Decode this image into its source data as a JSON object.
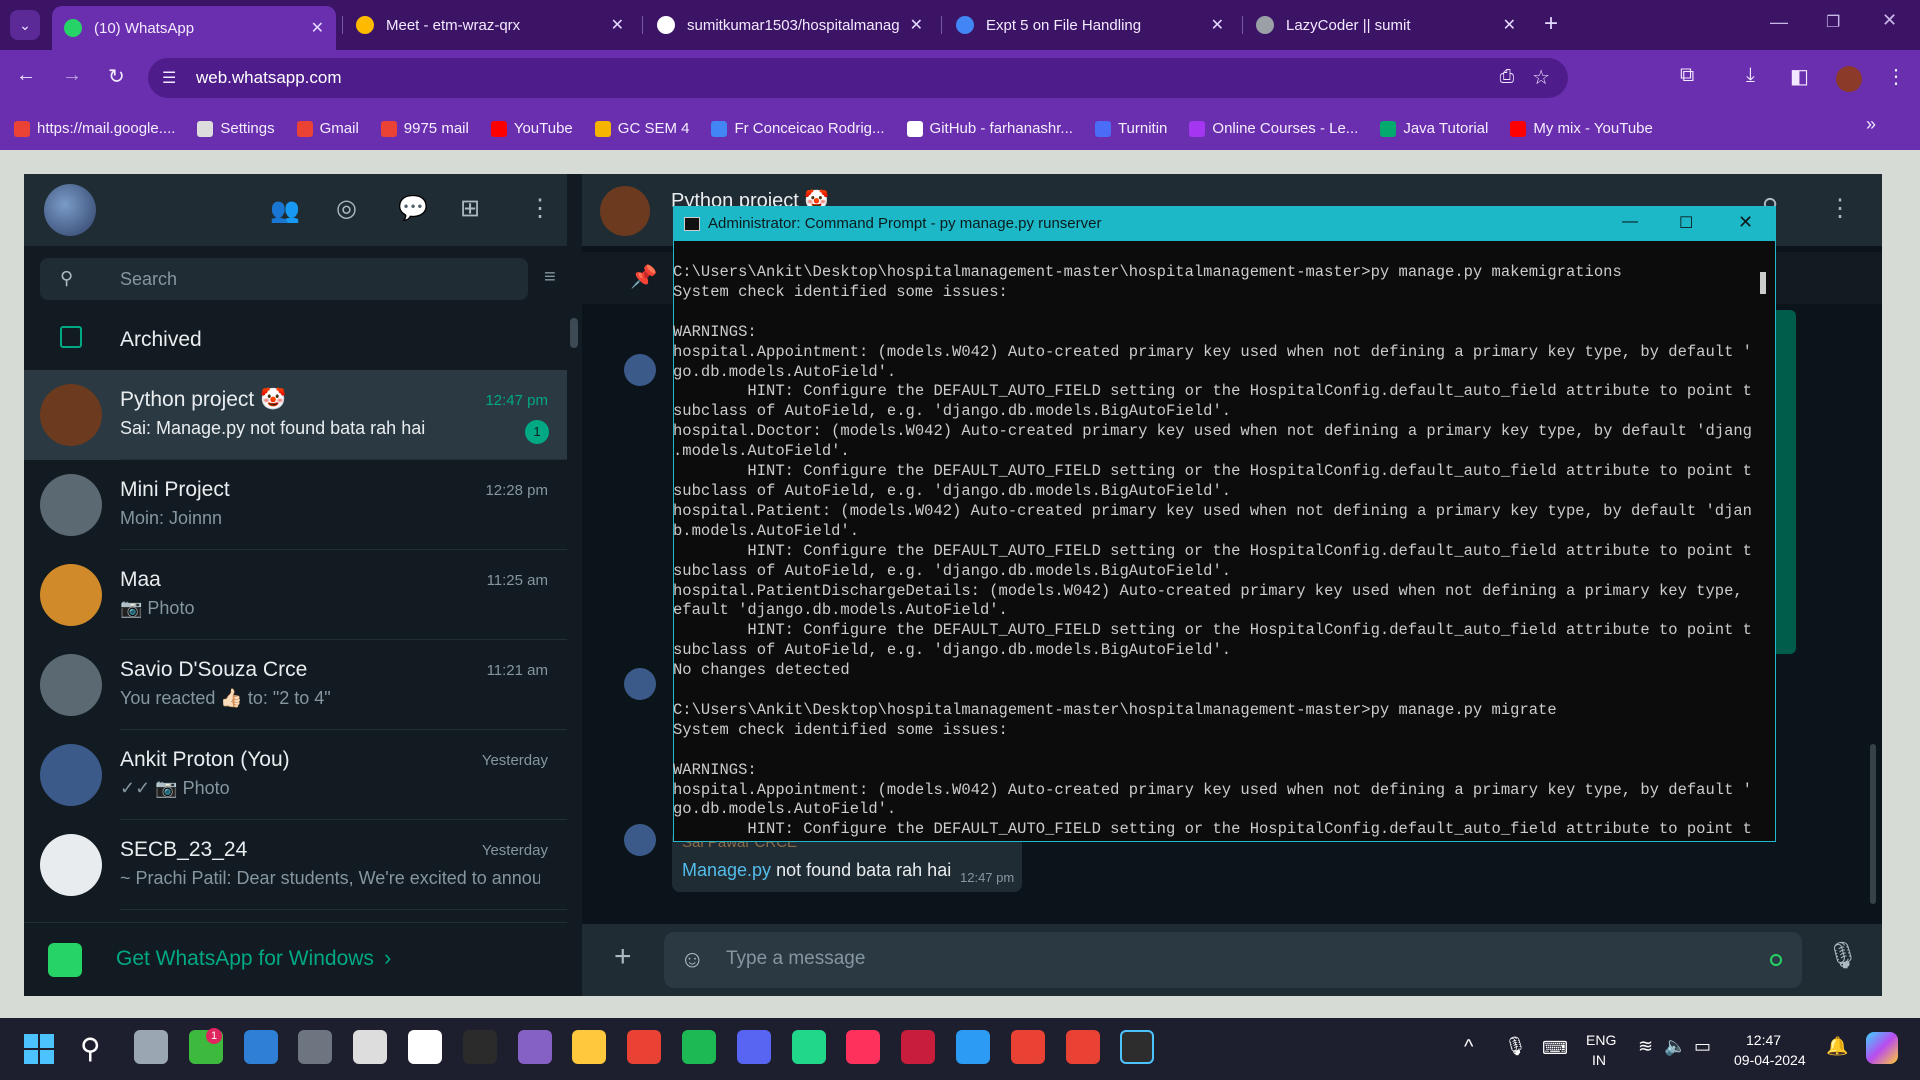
{
  "browser": {
    "tabs": [
      {
        "title": "(10) WhatsApp",
        "color": "#25d366"
      },
      {
        "title": "Meet - etm-wraz-qrx",
        "color": "#ffba00"
      },
      {
        "title": "sumitkumar1503/hospitalmanag",
        "color": "#ffffff"
      },
      {
        "title": "Expt 5 on File Handling",
        "color": "#4285f4"
      },
      {
        "title": "LazyCoder || sumit",
        "color": "#9aa0a6"
      }
    ],
    "url": "web.whatsapp.com",
    "bookmarks": [
      {
        "label": "https://mail.google....",
        "color": "#ea4335"
      },
      {
        "label": "Settings",
        "color": "#dddddd"
      },
      {
        "label": "Gmail",
        "color": "#ea4335"
      },
      {
        "label": "9975 mail",
        "color": "#ea4335"
      },
      {
        "label": "YouTube",
        "color": "#ff0000"
      },
      {
        "label": "GC SEM 4",
        "color": "#f4b400"
      },
      {
        "label": "Fr Conceicao Rodrig...",
        "color": "#4285f4"
      },
      {
        "label": "GitHub - farhanashr...",
        "color": "#ffffff"
      },
      {
        "label": "Turnitin",
        "color": "#4a6cf7"
      },
      {
        "label": "Online Courses - Le...",
        "color": "#a435f0"
      },
      {
        "label": "Java Tutorial",
        "color": "#04aa6d"
      },
      {
        "label": "My mix - YouTube",
        "color": "#ff0000"
      }
    ]
  },
  "sidebar": {
    "search_placeholder": "Search",
    "archived_label": "Archived",
    "chats": [
      {
        "name": "Python project 🤡",
        "message": "Sai: Manage.py not found bata rah hai",
        "time": "12:47 pm",
        "unread": "1",
        "avatar_color": "#6b3a1f"
      },
      {
        "name": "Mini Project",
        "message": "Moin: Joinnn",
        "time": "12:28 pm",
        "unread": "",
        "avatar_color": "#5b6a72"
      },
      {
        "name": "Maa",
        "message": "📷 Photo",
        "time": "11:25 am",
        "unread": "",
        "avatar_color": "#d08a2a"
      },
      {
        "name": "Savio D'Souza Crce",
        "message": "You reacted 👍🏻 to: \"2 to 4\"",
        "time": "11:21 am",
        "unread": "",
        "avatar_color": "#5b6a72"
      },
      {
        "name": "Ankit Proton (You)",
        "message": "✓✓ 📷 Photo",
        "time": "Yesterday",
        "unread": "",
        "avatar_color": "#3b5a8a"
      },
      {
        "name": "SECB_23_24",
        "message": "~ Prachi Patil: Dear students, We're excited to annou...",
        "time": "Yesterday",
        "unread": "",
        "avatar_color": "#e9ecef"
      }
    ],
    "get_app_label": "Get WhatsApp for Windows"
  },
  "chat": {
    "title": "Python project 🤡",
    "visible_message": {
      "link": "Manage.py",
      "rest": " not found bata rah hai",
      "time": "12:47 pm",
      "sender": "Sai Pawar CRCE"
    },
    "composer_placeholder": "Type a message"
  },
  "cmd": {
    "title": "Administrator: Command Prompt - py  manage.py runserver",
    "lines": [
      "C:\\Users\\Ankit\\Desktop\\hospitalmanagement-master\\hospitalmanagement-master>py manage.py makemigrations",
      "System check identified some issues:",
      "",
      "WARNINGS:",
      "hospital.Appointment: (models.W042) Auto-created primary key used when not defining a primary key type, by default 'djan",
      "go.db.models.AutoField'.",
      "        HINT: Configure the DEFAULT_AUTO_FIELD setting or the HospitalConfig.default_auto_field attribute to point to a",
      "subclass of AutoField, e.g. 'django.db.models.BigAutoField'.",
      "hospital.Doctor: (models.W042) Auto-created primary key used when not defining a primary key type, by default 'django.db",
      ".models.AutoField'.",
      "        HINT: Configure the DEFAULT_AUTO_FIELD setting or the HospitalConfig.default_auto_field attribute to point to a",
      "subclass of AutoField, e.g. 'django.db.models.BigAutoField'.",
      "hospital.Patient: (models.W042) Auto-created primary key used when not defining a primary key type, by default 'django.d",
      "b.models.AutoField'.",
      "        HINT: Configure the DEFAULT_AUTO_FIELD setting or the HospitalConfig.default_auto_field attribute to point to a",
      "subclass of AutoField, e.g. 'django.db.models.BigAutoField'.",
      "hospital.PatientDischargeDetails: (models.W042) Auto-created primary key used when not defining a primary key type, by d",
      "efault 'django.db.models.AutoField'.",
      "        HINT: Configure the DEFAULT_AUTO_FIELD setting or the HospitalConfig.default_auto_field attribute to point to a",
      "subclass of AutoField, e.g. 'django.db.models.BigAutoField'.",
      "No changes detected",
      "",
      "C:\\Users\\Ankit\\Desktop\\hospitalmanagement-master\\hospitalmanagement-master>py manage.py migrate",
      "System check identified some issues:",
      "",
      "WARNINGS:",
      "hospital.Appointment: (models.W042) Auto-created primary key used when not defining a primary key type, by default 'djan",
      "go.db.models.AutoField'.",
      "        HINT: Configure the DEFAULT_AUTO_FIELD setting or the HospitalConfig.default_auto_field attribute to point to a"
    ]
  },
  "taskbar": {
    "lang": "ENG",
    "region": "IN",
    "time": "12:47",
    "date": "09-04-2024",
    "notification_badge": "1",
    "apps": [
      {
        "name": "file-manager",
        "color": "#9aa7b3"
      },
      {
        "name": "chat-app",
        "color": "#3dba3d"
      },
      {
        "name": "desktop",
        "color": "#2f7fd6"
      },
      {
        "name": "calculator",
        "color": "#6d7680"
      },
      {
        "name": "unity",
        "color": "#dddddd"
      },
      {
        "name": "unreal",
        "color": "#ffffff"
      },
      {
        "name": "epic-games",
        "color": "#2b2b2b"
      },
      {
        "name": "visual-studio",
        "color": "#8661c5"
      },
      {
        "name": "file-explorer",
        "color": "#ffc83d"
      },
      {
        "name": "chrome",
        "color": "#e94235"
      },
      {
        "name": "spotify",
        "color": "#1db954"
      },
      {
        "name": "discord",
        "color": "#5865f2"
      },
      {
        "name": "pycharm",
        "color": "#21d789"
      },
      {
        "name": "intellij",
        "color": "#fe315d"
      },
      {
        "name": "red-app",
        "color": "#c81d3b"
      },
      {
        "name": "vscode",
        "color": "#2b9bf3"
      },
      {
        "name": "chrome-2",
        "color": "#e94235"
      },
      {
        "name": "chrome-3",
        "color": "#e94235"
      },
      {
        "name": "terminal",
        "color": "#2d2d2d"
      }
    ]
  }
}
